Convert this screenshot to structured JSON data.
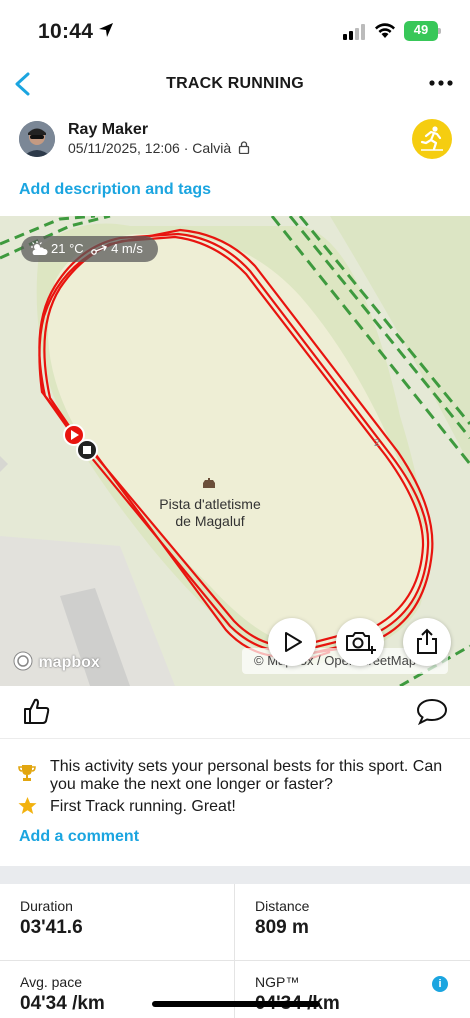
{
  "status_bar": {
    "time": "10:44",
    "battery": "49"
  },
  "nav": {
    "title": "TRACK RUNNING"
  },
  "header": {
    "user_name": "Ray Maker",
    "datetime_location": "05/11/2025, 12:06 · Calvià"
  },
  "description_link": "Add description and tags",
  "map": {
    "temperature": "21 °C",
    "wind": "4 m/s",
    "poi_name_line1": "Pista d'atletisme",
    "poi_name_line2": "de Magaluf",
    "logo": "mapbox",
    "attribution": "© Mapbox / OpenStreetMap",
    "buttons": [
      "play-icon",
      "camera-add-icon",
      "share-icon"
    ],
    "route_color": "#e8140f"
  },
  "achievements": [
    {
      "icon": "trophy-icon",
      "text": "This activity sets your personal bests for this sport. Can you make the next one longer or faster?"
    },
    {
      "icon": "star-icon",
      "text": "First Track running. Great!"
    }
  ],
  "comment_link": "Add a comment",
  "stats": [
    {
      "label": "Duration",
      "value": "03'41.6"
    },
    {
      "label": "Distance",
      "value": "809 m"
    },
    {
      "label": "Avg. pace",
      "value": "04'34 /km"
    },
    {
      "label": "NGP™",
      "value": "04'34 /km"
    }
  ],
  "colors": {
    "accent": "#1ba5e0",
    "badge": "#f5cd10",
    "route": "#e8140f"
  }
}
